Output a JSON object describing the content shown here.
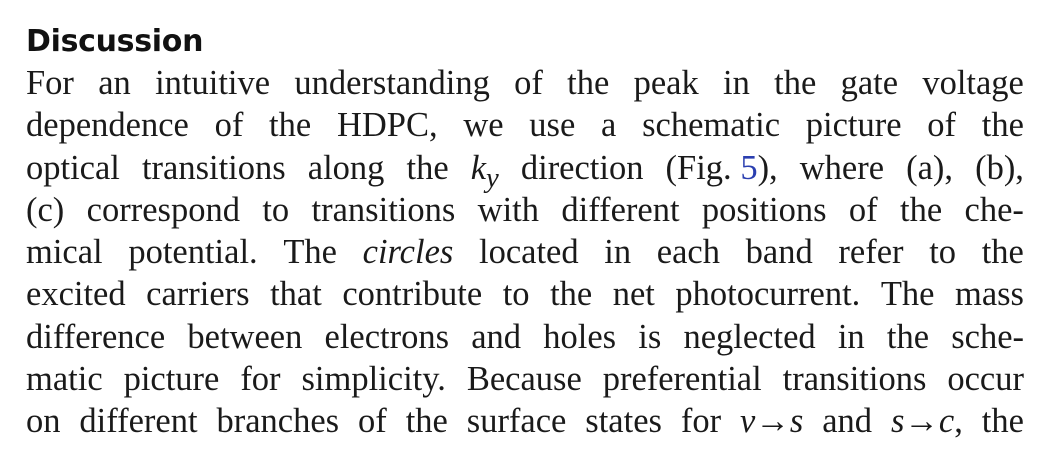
{
  "heading": "Discussion",
  "lines": [
    [
      "For",
      "an",
      "intuitive",
      "understanding",
      "of",
      "the",
      "peak",
      "in",
      "the",
      "gate",
      "voltage"
    ],
    [
      "dependence",
      "of",
      "the",
      "HDPC,",
      "we",
      "use",
      "a",
      "schematic",
      "picture",
      "of",
      "the"
    ],
    [
      "optical",
      "transitions",
      "along",
      "the",
      "k_y",
      "direction",
      "(Fig. 5),",
      "where",
      "(a),",
      "(b),"
    ],
    [
      "(c)",
      "correspond",
      "to",
      "transitions",
      "with",
      "different",
      "positions",
      "of",
      "the",
      "che-"
    ],
    [
      "mical",
      "potential.",
      "The",
      "circles",
      "located",
      "in",
      "each",
      "band",
      "refer",
      "to",
      "the"
    ],
    [
      "excited",
      "carriers",
      "that",
      "contribute",
      "to",
      "the",
      "net",
      "photocurrent.",
      "The",
      "mass"
    ],
    [
      "difference",
      "between",
      "electrons",
      "and",
      "holes",
      "is",
      "neglected",
      "in",
      "the",
      "sche-"
    ],
    [
      "matic",
      "picture",
      "for",
      "simplicity.",
      "Because",
      "preferential",
      "transitions",
      "occur"
    ],
    [
      "on",
      "different",
      "branches",
      "of",
      "the",
      "surface",
      "states",
      "for",
      "v→s",
      "and",
      "s→c,",
      "the"
    ]
  ],
  "figure_ref": "5",
  "accent_color": "#2b3fb0"
}
